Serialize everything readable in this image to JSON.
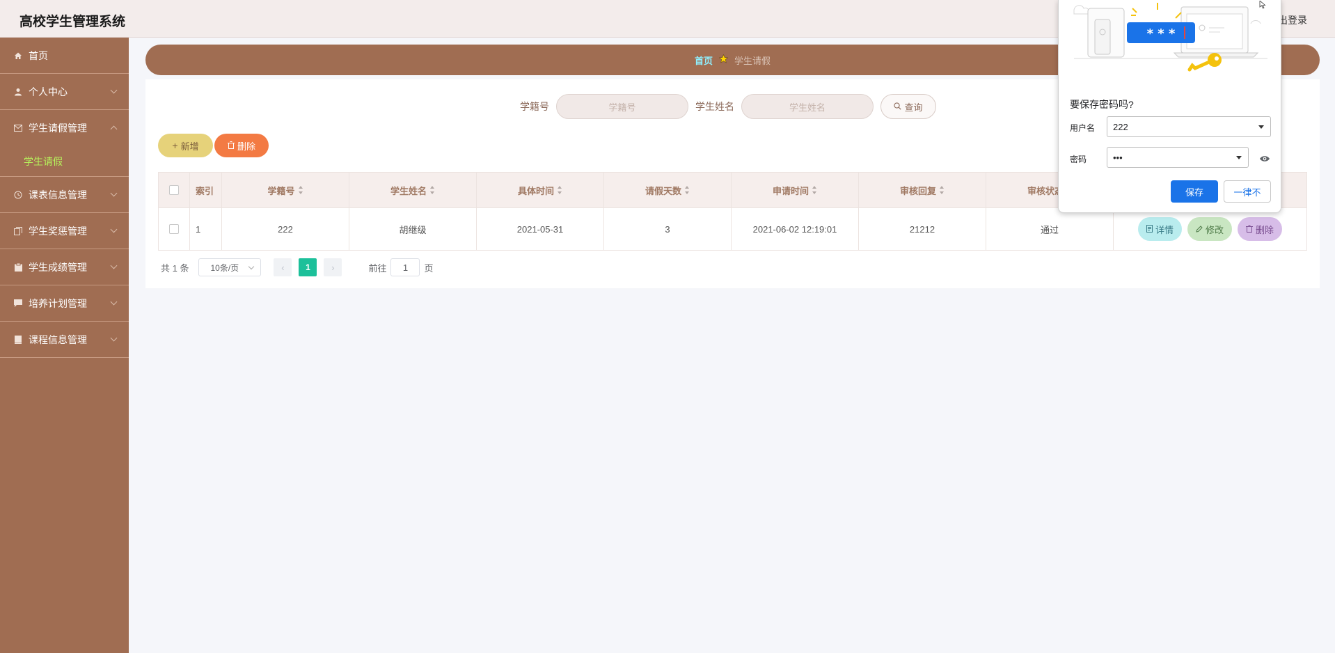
{
  "header": {
    "title": "高校学生管理系统",
    "logout": "出登录"
  },
  "sidebar": {
    "items": [
      {
        "label": "首页",
        "icon": "home-icon"
      },
      {
        "label": "个人中心",
        "icon": "user-icon"
      },
      {
        "label": "学生请假管理",
        "icon": "mail-icon",
        "open": true,
        "children": [
          "学生请假"
        ]
      },
      {
        "label": "课表信息管理",
        "icon": "clock-icon"
      },
      {
        "label": "学生奖惩管理",
        "icon": "copy-icon"
      },
      {
        "label": "学生成绩管理",
        "icon": "clipboard-icon"
      },
      {
        "label": "培养计划管理",
        "icon": "chat-icon"
      },
      {
        "label": "课程信息管理",
        "icon": "book-icon"
      }
    ]
  },
  "breadcrumb": {
    "home": "首页",
    "current": "学生请假"
  },
  "search": {
    "student_id_label": "学籍号",
    "student_id_placeholder": "学籍号",
    "student_name_label": "学生姓名",
    "student_name_placeholder": "学生姓名",
    "query_button": "查询"
  },
  "actions": {
    "add": "新增",
    "delete": "删除"
  },
  "table": {
    "columns": [
      "索引",
      "学籍号",
      "学生姓名",
      "具体时间",
      "请假天数",
      "申请时间",
      "审核回复",
      "审核状态"
    ],
    "rows": [
      {
        "index": "1",
        "student_id": "222",
        "name": "胡继级",
        "date": "2021-05-31",
        "days": "3",
        "apply_time": "2021-06-02 12:19:01",
        "reply": "21212",
        "status": "通过"
      }
    ],
    "row_actions": {
      "detail": "详情",
      "edit": "修改",
      "delete": "删除"
    }
  },
  "pagination": {
    "total": "共 1 条",
    "page_size": "10条/页",
    "current_page": "1",
    "goto_prefix": "前往",
    "goto_value": "1",
    "goto_suffix": "页"
  },
  "password_popup": {
    "question": "要保存密码吗?",
    "username_label": "用户名",
    "username_value": "222",
    "password_label": "密码",
    "password_value": "•••",
    "save_button": "保存",
    "never_button": "一律不",
    "illustration_text": "* * *"
  },
  "colors": {
    "sidebar": "#a06d52",
    "accent_green": "#1cc09a",
    "save_blue": "#1a73e8"
  }
}
